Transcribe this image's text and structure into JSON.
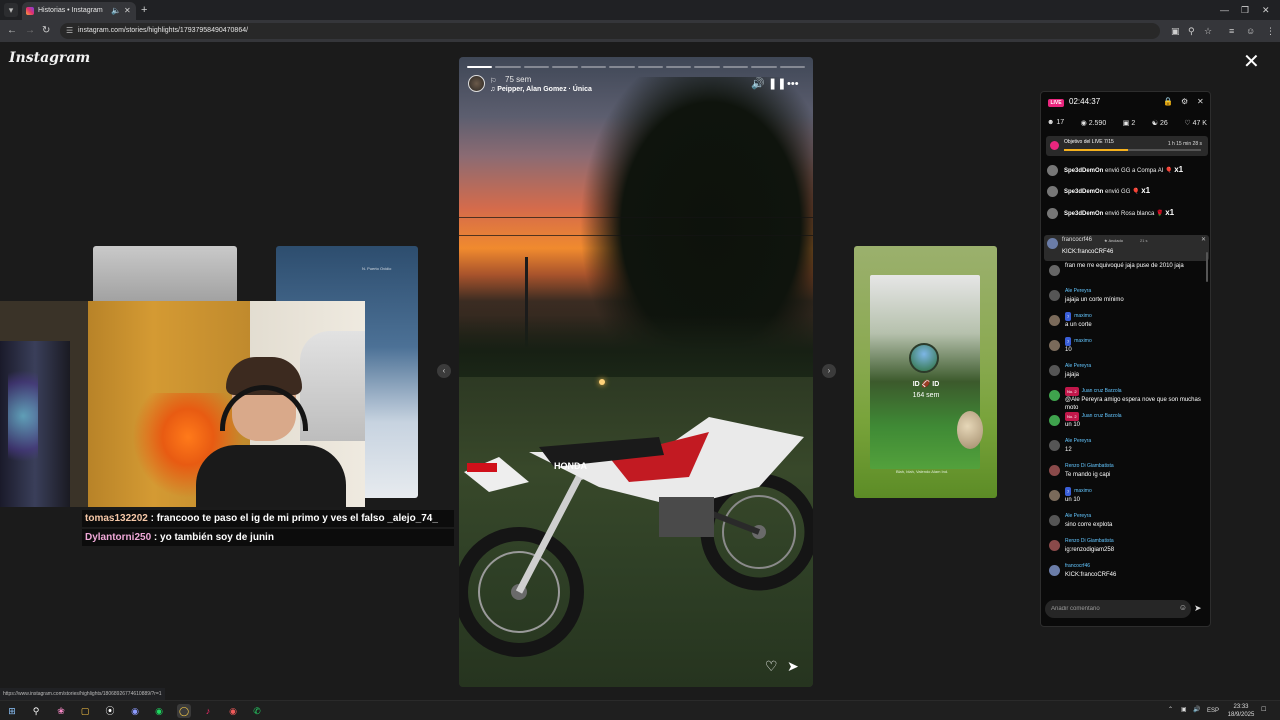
{
  "browser": {
    "tab_title": "Historias • Instagram",
    "new_tab_icon": "+",
    "url": "instagram.com/stories/highlights/17937958490470864/",
    "status_url": "https://www.instagram.com/stories/highlights/18068926774610889/?r=1"
  },
  "page": {
    "logo": "Instagram"
  },
  "side_cards": {
    "card2_tag": "N. Puerto Ovidio",
    "card3_user": "ID 🏈 ID",
    "card3_time": "164 sem",
    "card3_caption": "Blah, blah, Valendo Alam Ind."
  },
  "story": {
    "segments": 12,
    "done_segments": 1,
    "time_ago": "75 sem",
    "music": "Peipper, Alan Gomez · Única"
  },
  "stream_chat": [
    {
      "user": "tomas132202",
      "text": " : francooo te paso el ig de mi primo y ves el falso _alejo_74_"
    },
    {
      "user": "Dylantorni250",
      "text": " : yo también soy de junin"
    }
  ],
  "live": {
    "badge": "LIVE",
    "timer": "02:44:37",
    "stats": [
      "17",
      "2.590",
      "2",
      "26",
      "47 K"
    ],
    "goal_label": "Objetivo del LIVE",
    "goal_count": "7/15",
    "goal_progress": 0.47,
    "goal_time": "1 h 15 min 28 s",
    "gifts": [
      {
        "user": "Spe3dDemOn",
        "action": "envió GG a Compa AI",
        "count": "x1"
      },
      {
        "user": "Spe3dDemOn",
        "action": "envió GG",
        "count": "x1"
      },
      {
        "user": "Spe3dDemOn",
        "action": "envió Rosa blanca",
        "count": "x1"
      }
    ],
    "pinned": {
      "user": "francocrf46",
      "tag": "Anclado",
      "ago": "21 s",
      "text": "KICK:francoCRF46"
    },
    "messages": [
      {
        "user": "",
        "badge": "",
        "text": "fran me rre equivoqué jaja puse de 2010 jaja"
      },
      {
        "user": "Ale Pereyra",
        "badge": "",
        "text": "jajaja un corte mínimo"
      },
      {
        "user": "maximo",
        "badge": "7",
        "text": "a un corte"
      },
      {
        "user": "maximo",
        "badge": "7",
        "text": "10"
      },
      {
        "user": "Ale Pereyra",
        "badge": "",
        "text": "jajaja"
      },
      {
        "user": "Juan cruz Barzola",
        "badge": "No. 2",
        "text": "@Ale Pereyra amigo espera nove que son muchas moto"
      },
      {
        "user": "Juan cruz Barzola",
        "badge": "No. 2",
        "text": "un 10"
      },
      {
        "user": "Ale Pereyra",
        "badge": "",
        "text": "12"
      },
      {
        "user": "Renzo  Di Giambatista",
        "badge": "",
        "text": "Te mando ig capi"
      },
      {
        "user": "maximo",
        "badge": "7",
        "text": "un 10"
      },
      {
        "user": "Ale Pereyra",
        "badge": "",
        "text": "sino corre explota"
      },
      {
        "user": "Renzo  Di Giambatista",
        "badge": "",
        "text": "ig:renzodigiam258"
      },
      {
        "user": "francocrf46",
        "badge": "",
        "text": "KICK:francoCRF46"
      }
    ],
    "composer_placeholder": "Añadir comentario"
  },
  "taskbar": {
    "lang": "ESP",
    "time": "23:33",
    "date": "18/9/2025"
  },
  "colors": {
    "live_pink": "#e9267e",
    "username_blue": "#63c6ff",
    "goal_yellow": "#f7b21d"
  }
}
